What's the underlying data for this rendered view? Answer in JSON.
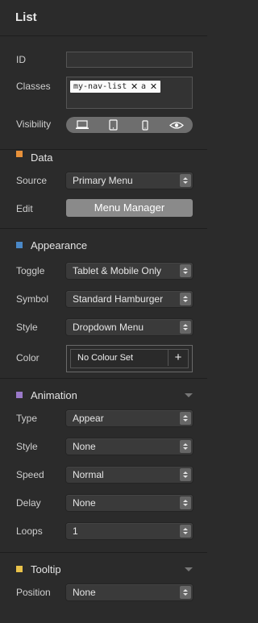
{
  "panel": {
    "title": "List"
  },
  "general": {
    "id_label": "ID",
    "id_value": "",
    "classes_label": "Classes",
    "classes": [
      "my-nav-list",
      "a"
    ],
    "visibility_label": "Visibility",
    "visibility_icons": [
      "desktop-icon",
      "tablet-icon",
      "phone-icon",
      "eye-icon"
    ]
  },
  "data_section": {
    "title": "Data",
    "color": "#e8913a",
    "source_label": "Source",
    "source_value": "Primary Menu",
    "edit_label": "Edit",
    "edit_button": "Menu Manager"
  },
  "appearance": {
    "title": "Appearance",
    "color": "#4a88c7",
    "toggle_label": "Toggle",
    "toggle_value": "Tablet & Mobile Only",
    "symbol_label": "Symbol",
    "symbol_value": "Standard Hamburger",
    "style_label": "Style",
    "style_value": "Dropdown Menu",
    "color_label": "Color",
    "color_value": "No Colour Set",
    "color_add": "+"
  },
  "animation": {
    "title": "Animation",
    "color": "#9a79c9",
    "type_label": "Type",
    "type_value": "Appear",
    "style_label": "Style",
    "style_value": "None",
    "speed_label": "Speed",
    "speed_value": "Normal",
    "delay_label": "Delay",
    "delay_value": "None",
    "loops_label": "Loops",
    "loops_value": "1"
  },
  "tooltip": {
    "title": "Tooltip",
    "color": "#e9c24a",
    "position_label": "Position",
    "position_value": "None"
  }
}
